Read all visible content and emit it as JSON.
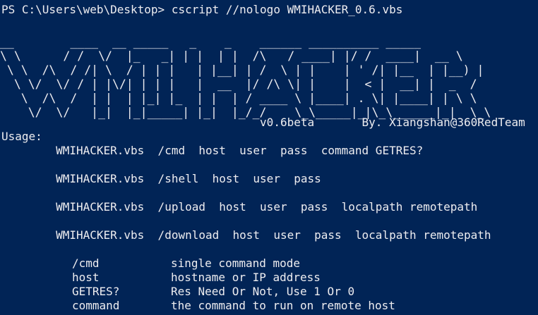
{
  "prompt": "PS C:\\Users\\web\\Desktop> cscript //nologo WMIHACKER_0.6.vbs",
  "banner_lines": [
    "__        ____  __ _____   _    _    ______ __________ _____",
    "\\ \\      / /  \\/  |_   _| | |  | |  /\\   / ____| |/ /  ____|  __ \\",
    " \\ \\  /\\  / /| \\  / | | |   | |__| | /  \\ | |    | ' /| |__  | |__) |",
    "  \\ \\/  \\/ / | |\\/| | | |   |  __  |/ /\\ \\| |    |  < |  __| |  _  /",
    "   \\  /\\  /  | |  | |_| |_  | |  | / ____ \\ |____| . \\| |____| | \\ \\",
    "    \\/  \\/   |_|  |_|_____| |_|  |_/_/    \\_\\_____|_|\\_\\______|_|  \\_\\"
  ],
  "version_line": "                                      v0.6beta       By. Xiangshan@360RedTeam",
  "usage_label": "Usage:",
  "usage_lines": [
    "        WMIHACKER.vbs  /cmd  host  user  pass  command GETRES?",
    "        WMIHACKER.vbs  /shell  host  user  pass",
    "        WMIHACKER.vbs  /upload  host  user  pass  localpath remotepath",
    "        WMIHACKER.vbs  /download  host  user  pass  localpath remotepath"
  ],
  "options": [
    {
      "key": "/cmd",
      "desc": "single command mode"
    },
    {
      "key": "host",
      "desc": "hostname or IP address"
    },
    {
      "key": "GETRES?",
      "desc": "Res Need Or Not, Use 1 Or 0"
    },
    {
      "key": "command",
      "desc": "the command to run on remote host"
    }
  ],
  "colors": {
    "background": "#012456",
    "foreground": "#eeedf0"
  }
}
